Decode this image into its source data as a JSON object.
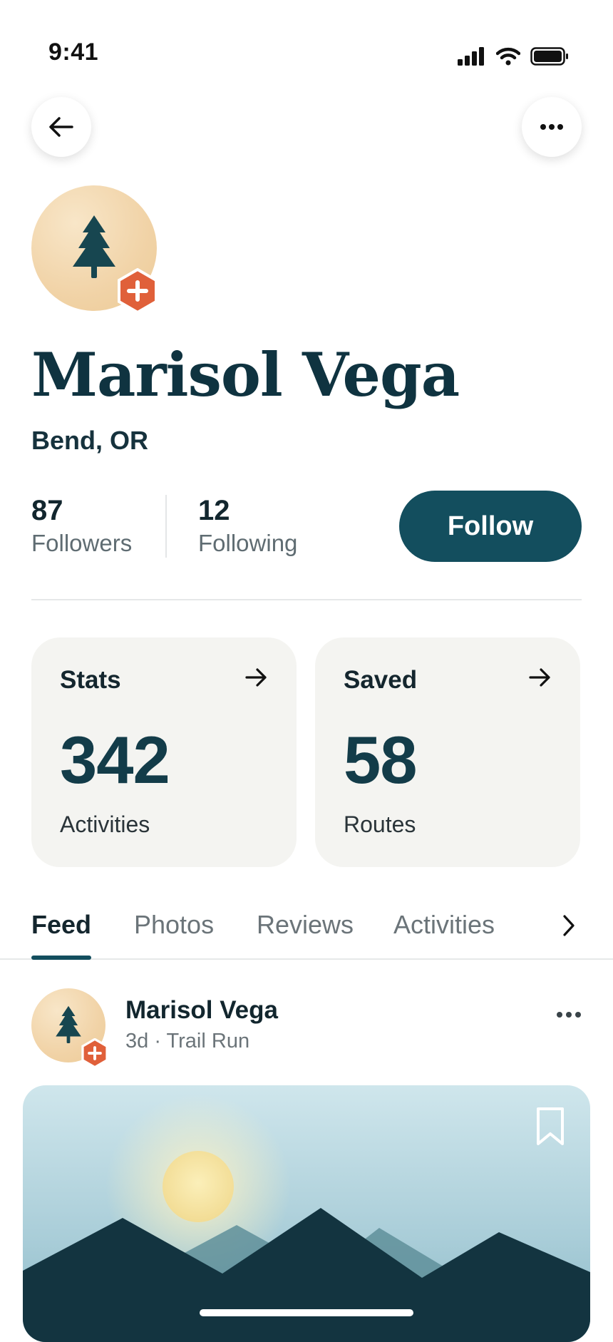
{
  "status_bar": {
    "time": "9:41"
  },
  "profile": {
    "name": "Marisol Vega",
    "location": "Bend, OR",
    "followers": {
      "count": "87",
      "label": "Followers"
    },
    "following": {
      "count": "12",
      "label": "Following"
    },
    "follow_label": "Follow"
  },
  "cards": [
    {
      "title": "Stats",
      "value": "342",
      "label": "Activities"
    },
    {
      "title": "Saved",
      "value": "58",
      "label": "Routes"
    }
  ],
  "tabs": [
    {
      "label": "Feed",
      "active": true
    },
    {
      "label": "Photos",
      "active": false
    },
    {
      "label": "Reviews",
      "active": false
    },
    {
      "label": "Activities",
      "active": false
    }
  ],
  "post": {
    "author": "Marisol Vega",
    "meta": "3d · Trail Run"
  },
  "colors": {
    "primary": "#134e5e",
    "badge": "#e0603a",
    "avatar_bg": "#f1d3a7",
    "card_bg": "#f4f4f1"
  },
  "icons": {
    "back": "arrow-left-icon",
    "more": "more-horizontal-icon",
    "tree": "tree-icon",
    "badge": "plus-hexagon-icon",
    "card_arrow": "arrow-right-icon",
    "tabs_next": "chevron-right-icon",
    "bookmark": "bookmark-icon"
  }
}
